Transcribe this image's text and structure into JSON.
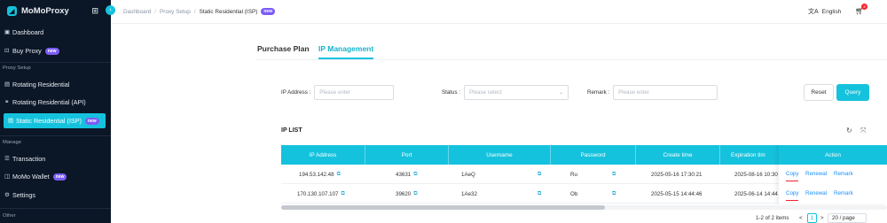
{
  "app": {
    "name": "MoMoProxy"
  },
  "sidebar": {
    "items": [
      {
        "label": "Dashboard",
        "icon": "dashboard-icon"
      },
      {
        "label": "Buy Proxy",
        "badge": "new",
        "icon": "cart-icon"
      },
      {
        "label": "Rotating Residential",
        "icon": "document-icon"
      },
      {
        "label": "Rotating Residential (API)",
        "icon": "link-icon"
      },
      {
        "label": "Static Residential (ISP)",
        "badge": "new",
        "icon": "document-icon",
        "active": true
      },
      {
        "label": "Transaction",
        "icon": "list-icon"
      },
      {
        "label": "MoMo Wallet",
        "badge": "new",
        "icon": "wallet-icon"
      },
      {
        "label": "Settings",
        "icon": "gear-icon"
      }
    ],
    "sections": {
      "proxy_setup": "Proxy Setup",
      "manage": "Manage",
      "other": "Other"
    }
  },
  "breadcrumb": {
    "items": [
      "Dashboard",
      "Proxy Setup",
      "Static Residential (ISP)"
    ],
    "badge": "new"
  },
  "header": {
    "language": "English",
    "cart_count": "2"
  },
  "tabs": [
    {
      "label": "Purchase Plan",
      "active": false
    },
    {
      "label": "IP Management",
      "active": true
    }
  ],
  "filters": {
    "ip_address": {
      "label": "IP Address :",
      "placeholder": "Please enter"
    },
    "status": {
      "label": "Status :",
      "placeholder": "Please select"
    },
    "remark": {
      "label": "Remark :",
      "placeholder": "Please enter"
    },
    "reset_label": "Reset",
    "query_label": "Query"
  },
  "ip_list": {
    "title": "IP LIST",
    "columns": [
      "IP Address",
      "Port",
      "Username",
      "Password",
      "Create time",
      "Expiration tim",
      "Action"
    ],
    "rows": [
      {
        "ip": "194.53.142.48",
        "port": "43631",
        "username": "1AeQ",
        "password": "Ru",
        "create_time": "2025-05-16 17:30:21",
        "expiration": "2025-08-16 10:30"
      },
      {
        "ip": "170.130.107.107",
        "port": "39620",
        "username": "1Ae32",
        "password": "Ob",
        "create_time": "2025-05-15 14:44:46",
        "expiration": "2025-06-14 14:44"
      }
    ],
    "actions": {
      "copy": "Copy",
      "renewal": "Renewal",
      "remark": "Remark"
    }
  },
  "pagination": {
    "summary": "1-2 of 2 items",
    "prev": "<",
    "current": "1",
    "next": ">",
    "page_size": "20 / page"
  },
  "colors": {
    "accent": "#15c2dd",
    "sidebar_bg": "#0b1626",
    "badge": "#7b5cf5",
    "link": "#1890ff"
  }
}
